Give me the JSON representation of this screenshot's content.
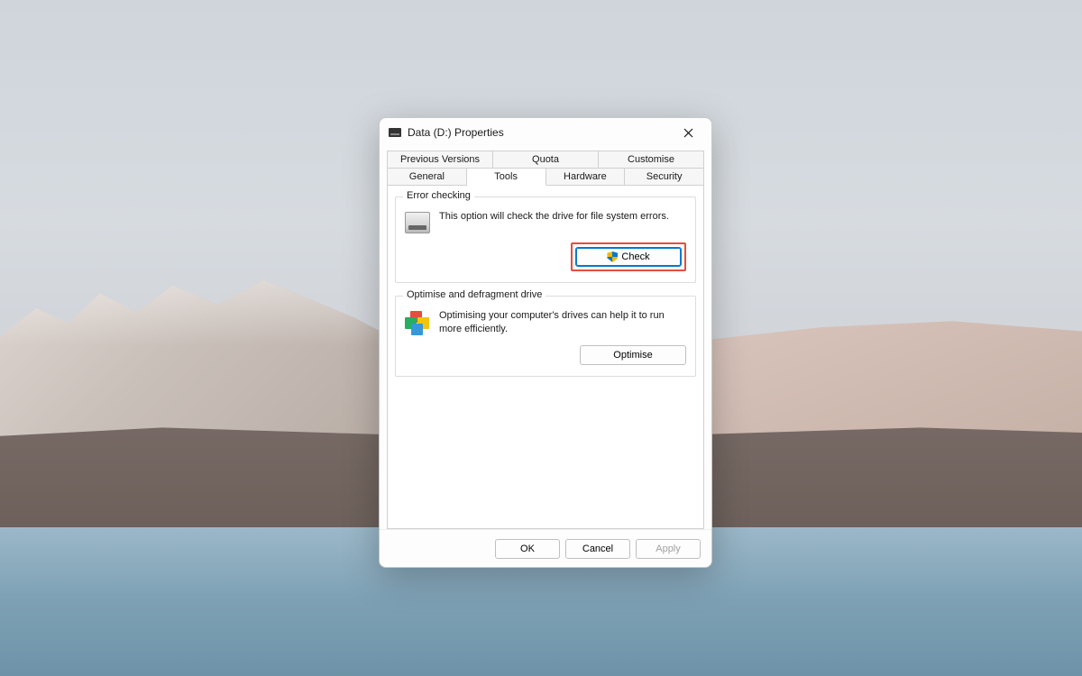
{
  "window": {
    "title": "Data (D:) Properties"
  },
  "tabs": {
    "row1": [
      {
        "label": "Previous Versions"
      },
      {
        "label": "Quota"
      },
      {
        "label": "Customise"
      }
    ],
    "row2": [
      {
        "label": "General"
      },
      {
        "label": "Tools",
        "active": true
      },
      {
        "label": "Hardware"
      },
      {
        "label": "Security"
      }
    ]
  },
  "groups": {
    "error_checking": {
      "title": "Error checking",
      "description": "This option will check the drive for file system errors.",
      "button_label": "Check"
    },
    "optimise": {
      "title": "Optimise and defragment drive",
      "description": "Optimising your computer's drives can help it to run more efficiently.",
      "button_label": "Optimise"
    }
  },
  "footer": {
    "ok": "OK",
    "cancel": "Cancel",
    "apply": "Apply"
  }
}
